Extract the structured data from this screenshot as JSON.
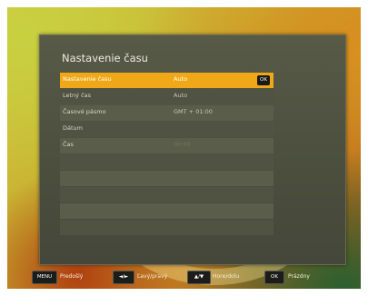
{
  "panel": {
    "title": "Nastavenie času"
  },
  "rows": [
    {
      "label": "Nastavenie času",
      "value": "Auto",
      "selected": true,
      "ok": "OK"
    },
    {
      "label": "Letný čas",
      "value": "Auto"
    },
    {
      "label": "Časové pásmo",
      "value": "GMT + 01:00"
    },
    {
      "label": "Dátum",
      "value": ""
    },
    {
      "label": "Čas",
      "value": "00:00"
    }
  ],
  "footer": {
    "menu_key": "MENU",
    "menu_label": "Predošlý",
    "lr_key": "◄/►",
    "lr_label": "Ľavý/pravý",
    "ud_key": "▲/▼",
    "ud_label": "Hore/dolu",
    "ok_key": "OK",
    "ok_label": "Prázdny"
  }
}
